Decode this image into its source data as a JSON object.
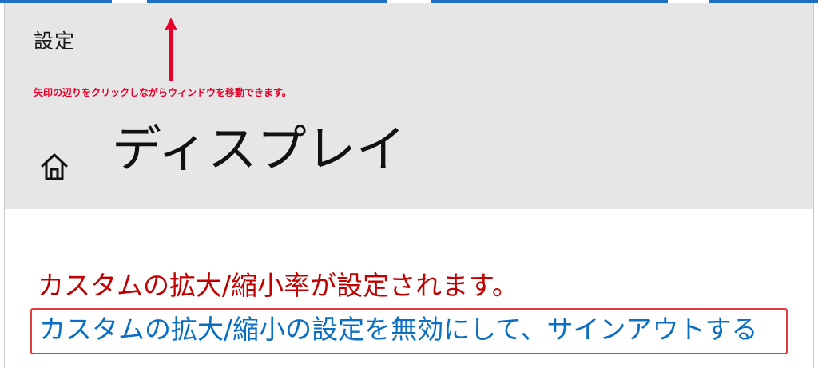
{
  "window": {
    "app_title": "設定",
    "page_title": "ディスプレイ"
  },
  "annotation": {
    "text": "矢印の辺りをクリックしながらウィンドウを移動できます。",
    "color": "#e8002a"
  },
  "icons": {
    "home": "home-icon",
    "arrow": "up-arrow-icon"
  },
  "content": {
    "status_message": "カスタムの拡大/縮小率が設定されます。",
    "signout_link": "カスタムの拡大/縮小の設定を無効にして、サインアウトする"
  },
  "colors": {
    "titlebar_bg": "#e6e6e6",
    "status_red": "#c00000",
    "link_blue": "#0a6fc2",
    "highlight_border": "#e03c3c"
  }
}
